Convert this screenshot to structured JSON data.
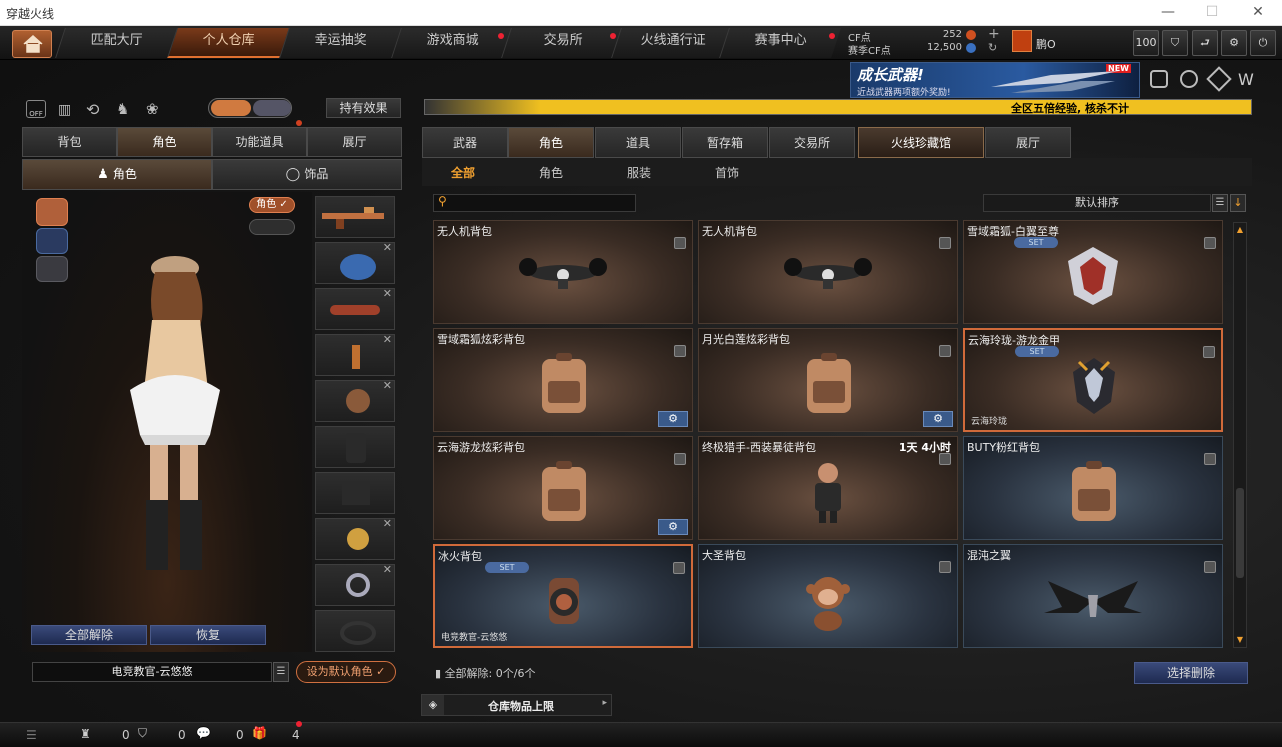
{
  "window": {
    "title": "穿越火线"
  },
  "topnav": {
    "tabs": [
      "匹配大厅",
      "个人仓库",
      "幸运抽奖",
      "游戏商城",
      "交易所",
      "火线通行证",
      "赛事中心"
    ],
    "active_tab": "个人仓库",
    "cf_label": "CF点",
    "cf_value": "252",
    "season_cf_label": "赛季CF点",
    "season_cf_value": "12,500",
    "username": "鹏O",
    "level": "100"
  },
  "banner": {
    "title": "成长武器!",
    "subtitle": "近战武器两项额外奖励!",
    "badge": "NEW",
    "ticker": "全区五倍经验, 核杀不计"
  },
  "left": {
    "toggle_label": "OFF",
    "effect_button": "持有效果",
    "tabs": [
      "背包",
      "角色",
      "功能道具",
      "展厅"
    ],
    "active_tab": "角色",
    "subtabs": [
      "角色",
      "饰品"
    ],
    "role_chip": "角色",
    "clear_all": "全部解除",
    "restore": "恢复",
    "character_name": "电竞教官-云悠悠",
    "set_default": "设为默认角色"
  },
  "right": {
    "tabs": [
      "武器",
      "角色",
      "道具",
      "暂存箱",
      "交易所",
      "火线珍藏馆",
      "展厅"
    ],
    "active_tab": "火线珍藏馆",
    "subtabs": [
      "全部",
      "角色",
      "服装",
      "首饰"
    ],
    "active_subtab": "全部",
    "search_placeholder": "",
    "sort_label": "默认排序",
    "items": [
      {
        "name": "无人机背包",
        "theme": "brown",
        "icon": "drone-icon"
      },
      {
        "name": "无人机背包",
        "theme": "brown",
        "icon": "drone-icon"
      },
      {
        "name": "雪域霜狐-白翼至尊",
        "theme": "brown",
        "set": "SET",
        "icon": "emblem-icon"
      },
      {
        "name": "雪域霜狐炫彩背包",
        "theme": "brown",
        "gear": true,
        "icon": "backpack-icon"
      },
      {
        "name": "月光白莲炫彩背包",
        "theme": "brown",
        "gear": true,
        "icon": "backpack-icon"
      },
      {
        "name": "云海玲珑-游龙金甲",
        "theme": "brown",
        "set": "SET",
        "highlight": true,
        "footer": "云海玲珑",
        "icon": "dragon-armor-icon"
      },
      {
        "name": "云海游龙炫彩背包",
        "theme": "brown",
        "gear": true,
        "icon": "backpack-icon"
      },
      {
        "name": "终极猎手-西装暴徒背包",
        "theme": "brown",
        "time": "1天 4小时",
        "icon": "figure-icon"
      },
      {
        "name": "BUTY粉红背包",
        "theme": "blue",
        "icon": "backpack-icon"
      },
      {
        "name": "冰火背包",
        "theme": "blue",
        "set": "SET",
        "highlight": true,
        "footer": "电竞教官-云悠悠",
        "icon": "jetpack-icon"
      },
      {
        "name": "大圣背包",
        "theme": "blue",
        "icon": "monkey-icon"
      },
      {
        "name": "混沌之翼",
        "theme": "blue",
        "icon": "wings-icon"
      }
    ],
    "clear_status": "全部解除: 0个/6个",
    "select_delete": "选择删除",
    "storage_limit": "仓库物品上限"
  },
  "bottombar": {
    "count1": "0",
    "count2": "0",
    "count3": "0",
    "gift": "4"
  },
  "colors": {
    "accent": "#e07030",
    "ticker": "#f0c020",
    "blue_card": "#2a3340"
  }
}
